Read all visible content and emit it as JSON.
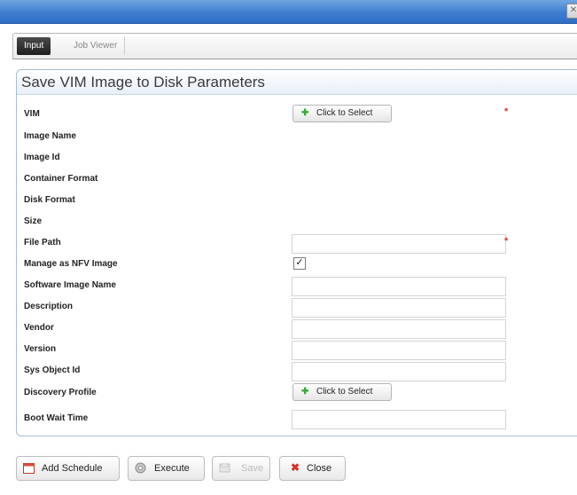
{
  "window": {
    "close_glyph": "✕"
  },
  "tabs": [
    {
      "label": "Input",
      "active": true
    },
    {
      "label": "Job Viewer",
      "active": false
    }
  ],
  "panel": {
    "title": "Save VIM Image to Disk Parameters"
  },
  "form": {
    "vim": {
      "label": "VIM",
      "button": "Click to Select",
      "required": true
    },
    "image_name": {
      "label": "Image Name"
    },
    "image_id": {
      "label": "Image Id"
    },
    "container_format": {
      "label": "Container Format"
    },
    "disk_format": {
      "label": "Disk Format"
    },
    "size": {
      "label": "Size"
    },
    "file_path": {
      "label": "File Path",
      "value": "",
      "required": true
    },
    "manage_nfv": {
      "label": "Manage as NFV Image",
      "checked": true
    },
    "software_image_name": {
      "label": "Software Image Name",
      "value": ""
    },
    "description": {
      "label": "Description",
      "value": ""
    },
    "vendor": {
      "label": "Vendor",
      "value": ""
    },
    "version": {
      "label": "Version",
      "value": ""
    },
    "sys_object_id": {
      "label": "Sys Object Id",
      "value": ""
    },
    "discovery_profile": {
      "label": "Discovery Profile",
      "button": "Click to Select"
    },
    "boot_wait_time": {
      "label": "Boot Wait Time",
      "value": ""
    },
    "required_glyph": "*"
  },
  "footer": {
    "add_schedule": "Add Schedule",
    "execute": "Execute",
    "save": "Save",
    "close": "Close"
  },
  "colors": {
    "titlebar": "#3e7dcf",
    "required": "#d9312b",
    "select_plus": "#3aa83a"
  },
  "icons": {
    "add_schedule": "calendar-icon",
    "execute": "gear-icon",
    "save": "save-icon",
    "close": "close-x-icon",
    "select": "plus-icon"
  }
}
